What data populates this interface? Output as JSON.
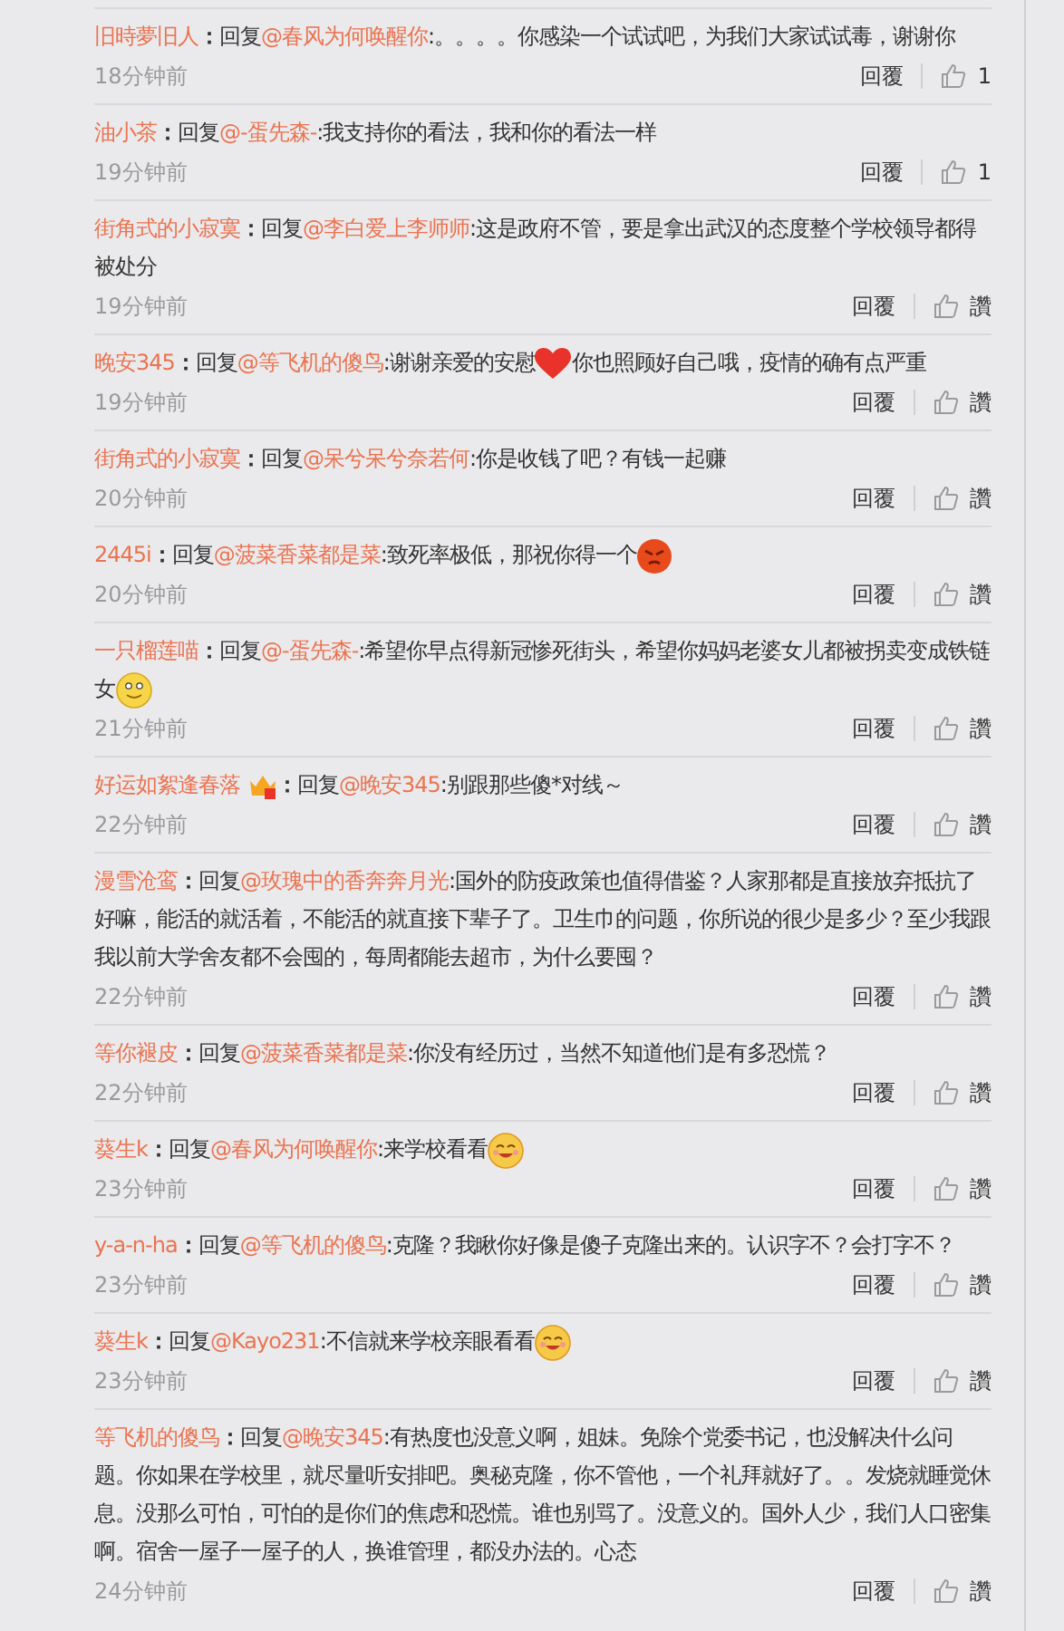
{
  "comments": [
    {
      "user": "旧時夢旧人",
      "badge": false,
      "colon": "：",
      "prefix": "回复",
      "mention": "@春风为何唤醒你",
      "body": [
        {
          "kind": "text",
          "text": ":。。。。你感染一个试试吧，为我们大家试试毒，谢谢你"
        }
      ],
      "time": "18分钟前",
      "reply": "回覆",
      "likes": "1"
    },
    {
      "user": "油小茶",
      "badge": false,
      "colon": "：",
      "prefix": "回复",
      "mention": "@-蛋先森-",
      "body": [
        {
          "kind": "text",
          "text": ":我支持你的看法，我和你的看法一样"
        }
      ],
      "time": "19分钟前",
      "reply": "回覆",
      "likes": "1"
    },
    {
      "user": "街角式的小寂寞",
      "badge": false,
      "prefix": "回复",
      "mention": "@李白爱上李师师",
      "colon": "：",
      "body": [
        {
          "kind": "text",
          "text": ":这是政府不管，要是拿出武汉的态度整个学校领导都得被处分"
        }
      ],
      "time": "19分钟前",
      "reply": "回覆",
      "likes": "讚"
    },
    {
      "user": "晚安345",
      "badge": false,
      "colon": "：",
      "prefix": "回复",
      "mention": "@等飞机的傻鸟",
      "body": [
        {
          "kind": "text",
          "text": ":谢谢亲爱的安慰"
        },
        {
          "kind": "heart"
        },
        {
          "kind": "text",
          "text": "你也照顾好自己哦，疫情的确有点严重"
        }
      ],
      "time": "19分钟前",
      "reply": "回覆",
      "likes": "讚"
    },
    {
      "user": "街角式的小寂寞",
      "badge": false,
      "prefix": "回复",
      "mention": "@呆兮呆兮奈若何",
      "colon": "：",
      "body": [
        {
          "kind": "text",
          "text": ":你是收钱了吧？有钱一起赚"
        }
      ],
      "time": "20分钟前",
      "reply": "回覆",
      "likes": "讚"
    },
    {
      "user": "2445i",
      "badge": false,
      "colon": "：",
      "prefix": "回复",
      "mention": "@菠菜香菜都是菜",
      "body": [
        {
          "kind": "text",
          "text": ":致死率极低，那祝你得一个"
        },
        {
          "kind": "angry"
        }
      ],
      "time": "20分钟前",
      "reply": "回覆",
      "likes": "讚"
    },
    {
      "user": "一只榴莲喵",
      "badge": false,
      "colon": "：",
      "prefix": "回复",
      "mention": "@-蛋先森-",
      "body": [
        {
          "kind": "text",
          "text": ":希望你早点得新冠惨死街头，希望你妈妈老婆女儿都被拐卖变成铁链女"
        },
        {
          "kind": "smile"
        }
      ],
      "time": "21分钟前",
      "reply": "回覆",
      "likes": "讚"
    },
    {
      "user": "好运如絮逢春落",
      "badge": true,
      "colon": "：",
      "prefix": "回复",
      "mention": "@晚安345",
      "body": [
        {
          "kind": "text",
          "text": ":别跟那些傻*对线～"
        }
      ],
      "time": "22分钟前",
      "reply": "回覆",
      "likes": "讚"
    },
    {
      "user": "漫雪沧鸾",
      "badge": false,
      "colon": "：",
      "prefix": "回复",
      "mention": "@玫瑰中的香奔奔月光",
      "body": [
        {
          "kind": "text",
          "text": ":国外的防疫政策也值得借鉴？人家那都是直接放弃抵抗了好嘛，能活的就活着，不能活的就直接下辈子了。卫生巾的问题，你所说的很少是多少？至少我跟我以前大学舍友都不会囤的，每周都能去超市，为什么要囤？"
        }
      ],
      "time": "22分钟前",
      "reply": "回覆",
      "likes": "讚"
    },
    {
      "user": "等你褪皮",
      "badge": false,
      "colon": "：",
      "prefix": "回复",
      "mention": "@菠菜香菜都是菜",
      "body": [
        {
          "kind": "text",
          "text": ":你没有经历过，当然不知道他们是有多恐慌？"
        }
      ],
      "time": "22分钟前",
      "reply": "回覆",
      "likes": "讚"
    },
    {
      "user": "葵生k",
      "badge": false,
      "prefix": "回复",
      "colon": "：",
      "mention": "@春风为何唤醒你",
      "body": [
        {
          "kind": "text",
          "text": ":来学校看看"
        },
        {
          "kind": "grin"
        }
      ],
      "time": "23分钟前",
      "reply": "回覆",
      "likes": "讚"
    },
    {
      "user": "y-a-n-ha",
      "badge": false,
      "colon": "：",
      "prefix": "回复",
      "mention": "@等飞机的傻鸟",
      "body": [
        {
          "kind": "text",
          "text": ":克隆？我瞅你好像是傻子克隆出来的。认识字不？会打字不？"
        }
      ],
      "time": "23分钟前",
      "reply": "回覆",
      "likes": "讚"
    },
    {
      "user": "葵生k",
      "badge": false,
      "prefix": "回复",
      "colon": "：",
      "mention": "@Kayo231",
      "body": [
        {
          "kind": "text",
          "text": ":不信就来学校亲眼看看"
        },
        {
          "kind": "grin"
        }
      ],
      "time": "23分钟前",
      "reply": "回覆",
      "likes": "讚"
    },
    {
      "user": "等飞机的傻鸟",
      "badge": false,
      "colon": "：",
      "prefix": "回复",
      "mention": "@晚安345",
      "body": [
        {
          "kind": "text",
          "text": ":有热度也没意义啊，姐妹。免除个党委书记，也没解决什么问题。你如果在学校里，就尽量听安排吧。奥秘克隆，你不管他，一个礼拜就好了。。发烧就睡觉休息。没那么可怕，可怕的是你们的焦虑和恐慌。谁也别骂了。没意义的。国外人少，我们人口密集啊。宿舍一屋子一屋子的人，换谁管理，都没办法的。心态"
        }
      ],
      "time": "24分钟前",
      "reply": "回覆",
      "likes": "讚"
    }
  ]
}
